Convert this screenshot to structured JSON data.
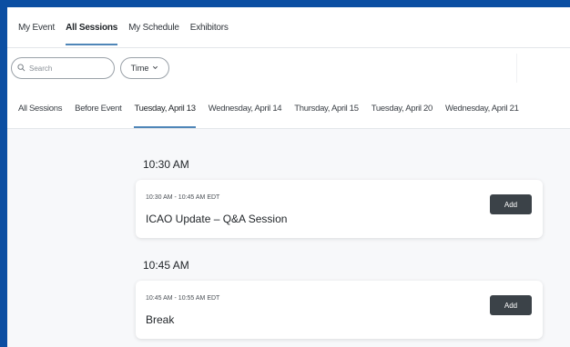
{
  "topnav": {
    "items": [
      {
        "label": "My Event"
      },
      {
        "label": "All Sessions"
      },
      {
        "label": "My Schedule"
      },
      {
        "label": "Exhibitors"
      }
    ]
  },
  "filters": {
    "search_placeholder": "Search",
    "time_label": "Time"
  },
  "date_tabs": [
    {
      "label": "All Sessions"
    },
    {
      "label": "Before Event"
    },
    {
      "label": "Tuesday, April 13"
    },
    {
      "label": "Wednesday, April 14"
    },
    {
      "label": "Thursday, April 15"
    },
    {
      "label": "Tuesday, April 20"
    },
    {
      "label": "Wednesday, April 21"
    }
  ],
  "groups": [
    {
      "heading": "10:30 AM",
      "session": {
        "time_range": "10:30 AM - 10:45 AM EDT",
        "title": "ICAO Update – Q&A Session",
        "add_label": "Add"
      }
    },
    {
      "heading": "10:45 AM",
      "session": {
        "time_range": "10:45 AM - 10:55 AM EDT",
        "title": "Break",
        "add_label": "Add"
      }
    }
  ],
  "colors": {
    "frame_border": "#0b4ea2",
    "tab_underline": "#4f86b8",
    "add_button": "#3b4248"
  }
}
